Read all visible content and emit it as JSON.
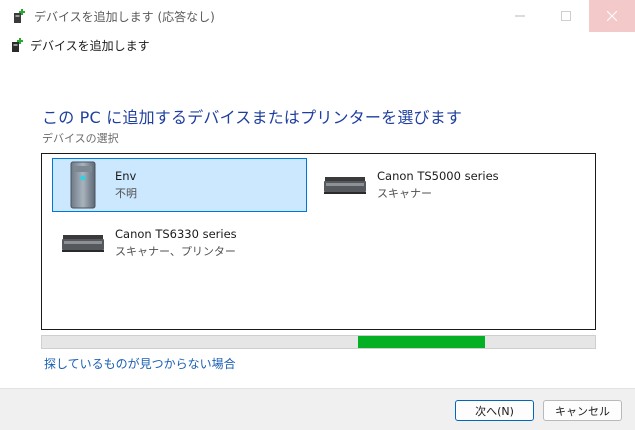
{
  "window": {
    "title": "デバイスを追加します (応答なし)",
    "header_label": "デバイスを追加します"
  },
  "content": {
    "heading": "この PC に追加するデバイスまたはプリンターを選びます",
    "subheading": "デバイスの選択"
  },
  "devices": [
    {
      "name": "Env",
      "status": "不明",
      "icon": "computer-tower-icon",
      "selected": true
    },
    {
      "name": "Canon TS5000 series",
      "status": "スキャナー",
      "icon": "scanner-icon",
      "selected": false
    },
    {
      "name": "Canon TS6330 series",
      "status": "スキャナー、プリンター",
      "icon": "printer-scanner-icon",
      "selected": false
    }
  ],
  "progress": {
    "color": "#06b025"
  },
  "links": {
    "not_found": "探しているものが見つからない場合"
  },
  "buttons": {
    "next": "次へ(N)",
    "cancel": "キャンセル"
  }
}
